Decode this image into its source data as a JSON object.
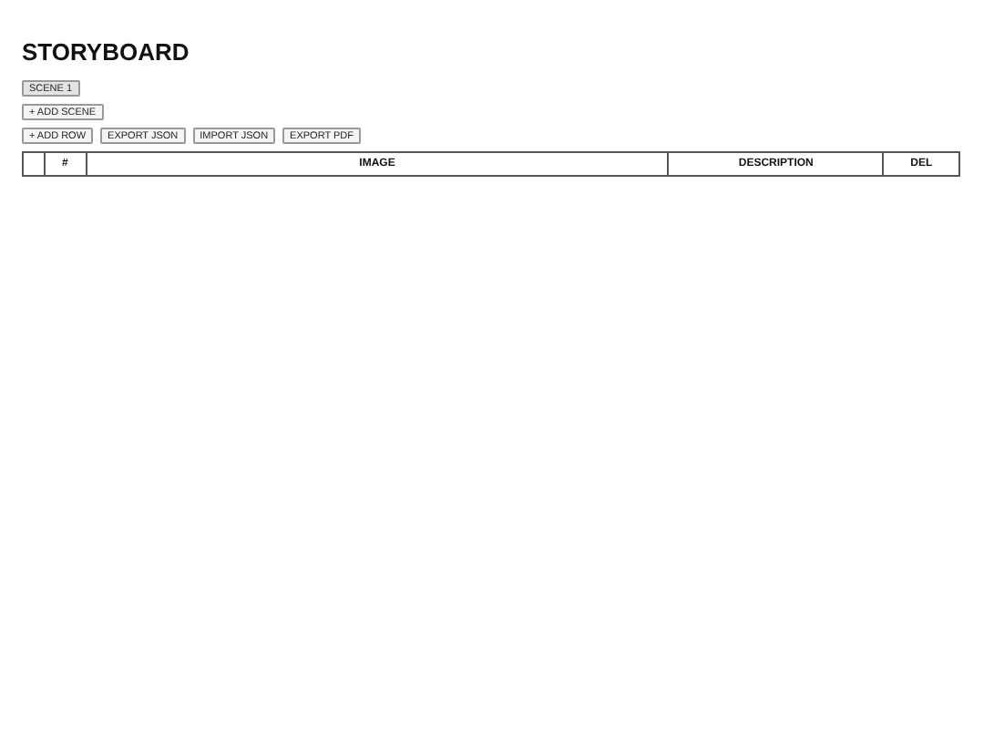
{
  "title": "STORYBOARD",
  "scenes": [
    {
      "label": "SCENE 1",
      "selected": true
    }
  ],
  "add_scene": "+ ADD SCENE",
  "toolbar": [
    "+ ADD ROW",
    "EXPORT JSON",
    "IMPORT JSON",
    "EXPORT PDF"
  ],
  "table": {
    "columns": [
      "",
      "#",
      "IMAGE",
      "DESCRIPTION",
      "DEL"
    ]
  }
}
